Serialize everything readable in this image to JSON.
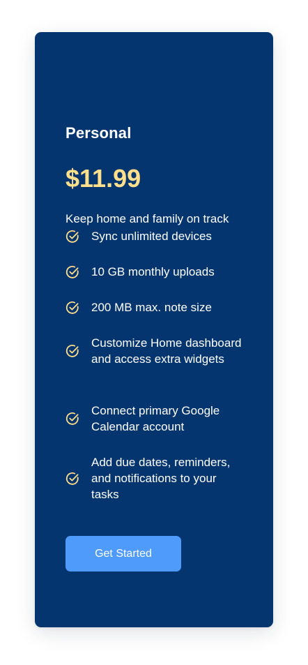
{
  "plan": {
    "name": "Personal",
    "price": "$11.99",
    "description": "Keep home and family on track",
    "features": [
      "Sync unlimited devices",
      "10 GB monthly uploads",
      "200 MB max. note size",
      "Customize Home dashboard and access extra widgets",
      "Connect primary Google Calendar account",
      "Add due dates, reminders, and notifications to your tasks"
    ],
    "cta_label": "Get Started"
  },
  "colors": {
    "card_background": "#05356f",
    "price_accent": "#fedf8b",
    "check_icon": "#fedf8b",
    "button": "#4f9bfb"
  },
  "icons": {
    "feature": "check-circle-icon"
  }
}
